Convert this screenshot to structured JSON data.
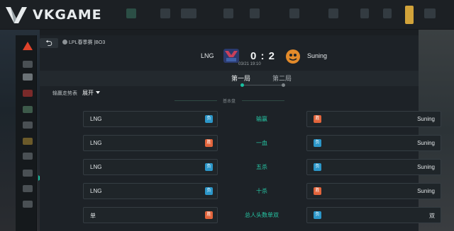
{
  "header": {
    "brand": "VKGAME"
  },
  "match": {
    "back_label": "⮌",
    "breadcrumb": "LPL春季赛 |BO3",
    "team_a": "LNG",
    "team_b": "Suning",
    "score": "0 : 2",
    "time": "03/21 19:10"
  },
  "tabs": [
    {
      "label": "第一局",
      "active": true
    },
    {
      "label": "第二局",
      "active": false
    }
  ],
  "trend": {
    "label": "输赢走势表",
    "toggle": "展开"
  },
  "section": {
    "title": "基本盘"
  },
  "bets": [
    {
      "left": "LNG",
      "left_badge": "负",
      "left_result": "lose",
      "type": "输赢",
      "right": "Suning",
      "right_badge": "胜",
      "right_result": "win"
    },
    {
      "left": "LNG",
      "left_badge": "胜",
      "left_result": "win",
      "type": "一血",
      "right": "Suning",
      "right_badge": "负",
      "right_result": "lose"
    },
    {
      "left": "LNG",
      "left_badge": "负",
      "left_result": "lose",
      "type": "五杀",
      "right": "Suning",
      "right_badge": "负",
      "right_result": "lose"
    },
    {
      "left": "LNG",
      "left_badge": "负",
      "left_result": "lose",
      "type": "十杀",
      "right": "Suning",
      "right_badge": "胜",
      "right_result": "win"
    },
    {
      "left": "单",
      "left_badge": "胜",
      "left_result": "win",
      "type": "总人头数单双",
      "right": "双",
      "right_badge": "负",
      "right_result": "lose"
    }
  ],
  "colors": {
    "accent": "#19c0a0",
    "win": "#e2643b",
    "lose": "#2c97c9",
    "warning": "#e0432b"
  }
}
